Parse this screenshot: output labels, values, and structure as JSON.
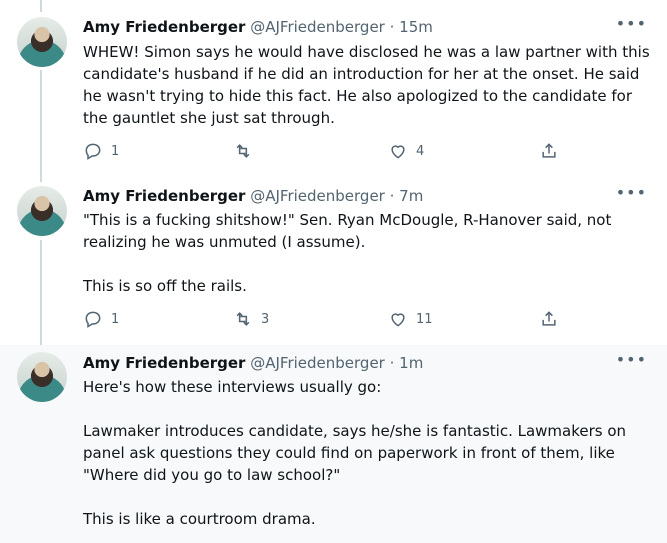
{
  "tweets": [
    {
      "name": "Amy Friedenberger",
      "handle": "@AJFriedenberger",
      "time": "· 15m",
      "text": "WHEW! Simon says he would have disclosed he was a law partner with this candidate's husband if he did an introduction for her at the onset. He said he wasn't trying to hide this fact. He also apologized to the candidate for the gauntlet she just sat through.",
      "replies": "1",
      "retweets": "",
      "likes": "4"
    },
    {
      "name": "Amy Friedenberger",
      "handle": "@AJFriedenberger",
      "time": "· 7m",
      "text": "\"This is a fucking shitshow!\" Sen. Ryan McDougle, R-Hanover said, not realizing he was unmuted (I assume).\n\nThis is so off the rails.",
      "replies": "1",
      "retweets": "3",
      "likes": "11"
    },
    {
      "name": "Amy Friedenberger",
      "handle": "@AJFriedenberger",
      "time": "· 1m",
      "text": "Here's how these interviews usually go:\n\nLawmaker introduces candidate, says he/she is fantastic. Lawmakers on panel ask questions they could find on paperwork in front of them, like \"Where did you go to law school?\"\n\nThis is like a courtroom drama."
    }
  ],
  "icons": {
    "reply": "reply-icon",
    "retweet": "retweet-icon",
    "like": "heart-icon",
    "share": "share-icon",
    "more": "more-icon"
  },
  "colors": {
    "text": "#0f1419",
    "secondary": "#536471",
    "highlight_bg": "#f7f9fa",
    "thread_line": "#cfd9de"
  }
}
